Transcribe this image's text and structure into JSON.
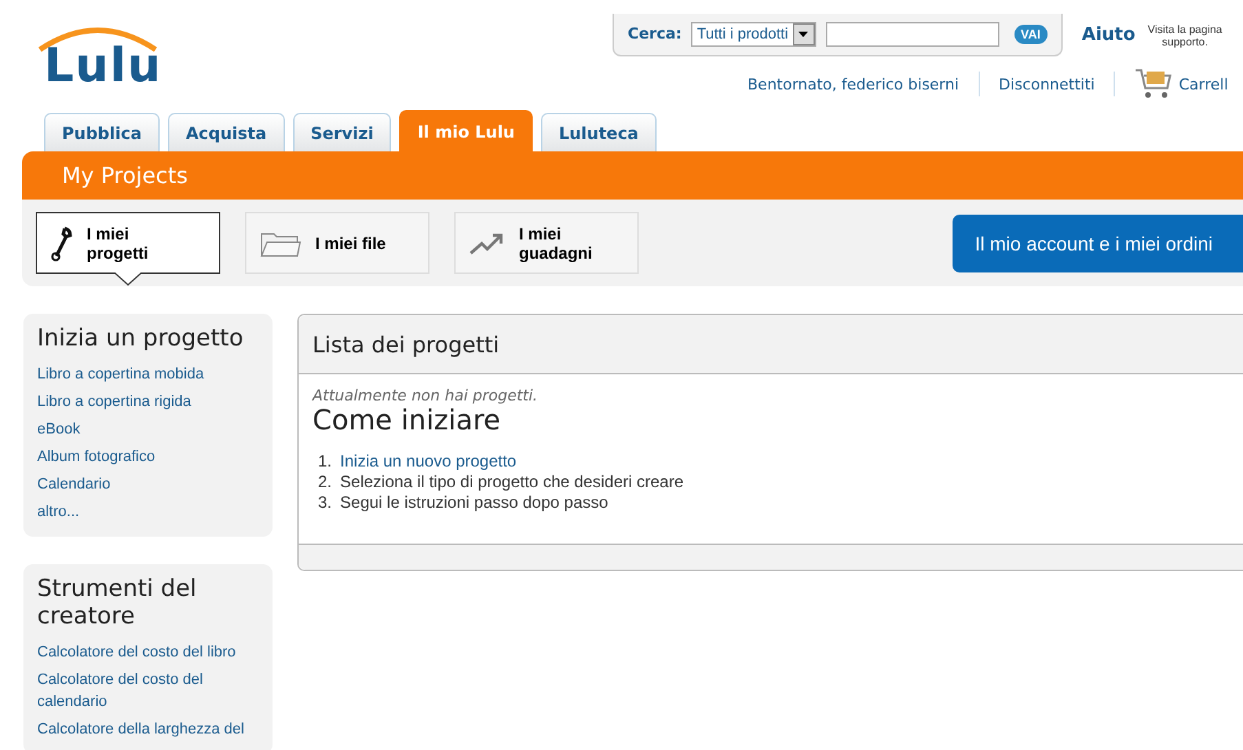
{
  "logo": {
    "text": "Lulu"
  },
  "search": {
    "label": "Cerca:",
    "scope": "Tutti i prodotti",
    "button": "VAI"
  },
  "help": {
    "title": "Aiuto",
    "subtitle": "Visita la pagina supporto."
  },
  "user_links": [
    "Bentornato, federico biserni",
    "Disconnettiti",
    "Carrell"
  ],
  "tabs": [
    {
      "label": "Pubblica",
      "selected": false
    },
    {
      "label": "Acquista",
      "selected": false
    },
    {
      "label": "Servizi",
      "selected": false
    },
    {
      "label": "Il mio Lulu",
      "selected": true
    },
    {
      "label": "Luluteca",
      "selected": false
    }
  ],
  "section_title": "My Projects",
  "subnav": [
    {
      "label": "I miei progetti",
      "kind": "wrench",
      "selected": true
    },
    {
      "label": "I miei file",
      "kind": "folder",
      "selected": false
    },
    {
      "label": "I miei guadagni",
      "kind": "chart",
      "selected": false
    }
  ],
  "account_button": "Il mio account e i miei ordini",
  "sidebar": [
    {
      "title": "Inizia un progetto",
      "links": [
        "Libro a copertina mobida",
        "Libro a copertina rigida",
        "eBook",
        "Album fotografico",
        "Calendario",
        "altro..."
      ]
    },
    {
      "title": "Strumenti del creatore",
      "links": [
        "Calcolatore del costo del libro",
        "Calcolatore del costo del calendario",
        "Calcolatore della larghezza del"
      ]
    }
  ],
  "panel": {
    "title": "Lista dei progetti",
    "notice": "Attualmente non hai progetti.",
    "heading": "Come iniziare",
    "steps": [
      {
        "number": "1.",
        "text": "Inizia un nuovo progetto",
        "kind": "link"
      },
      {
        "number": "2.",
        "text": "Seleziona il tipo di progetto che desideri creare",
        "kind": "plain"
      },
      {
        "number": "3.",
        "text": "Segui le istruzioni passo dopo passo",
        "kind": "plain"
      }
    ]
  }
}
